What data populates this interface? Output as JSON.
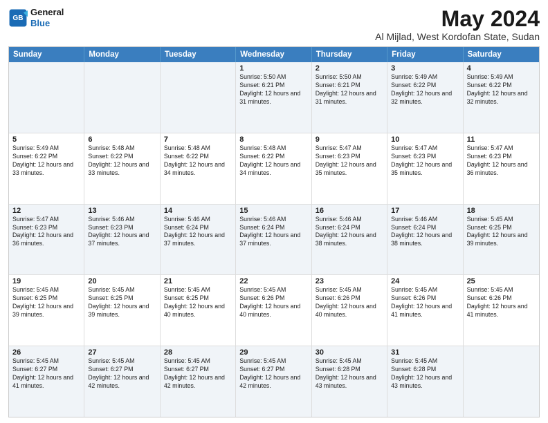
{
  "logo": {
    "general": "General",
    "blue": "Blue"
  },
  "title": "May 2024",
  "subtitle": "Al Mijlad, West Kordofan State, Sudan",
  "headers": [
    "Sunday",
    "Monday",
    "Tuesday",
    "Wednesday",
    "Thursday",
    "Friday",
    "Saturday"
  ],
  "rows": [
    [
      {
        "day": "",
        "text": ""
      },
      {
        "day": "",
        "text": ""
      },
      {
        "day": "",
        "text": ""
      },
      {
        "day": "1",
        "text": "Sunrise: 5:50 AM\nSunset: 6:21 PM\nDaylight: 12 hours and 31 minutes."
      },
      {
        "day": "2",
        "text": "Sunrise: 5:50 AM\nSunset: 6:21 PM\nDaylight: 12 hours and 31 minutes."
      },
      {
        "day": "3",
        "text": "Sunrise: 5:49 AM\nSunset: 6:22 PM\nDaylight: 12 hours and 32 minutes."
      },
      {
        "day": "4",
        "text": "Sunrise: 5:49 AM\nSunset: 6:22 PM\nDaylight: 12 hours and 32 minutes."
      }
    ],
    [
      {
        "day": "5",
        "text": "Sunrise: 5:49 AM\nSunset: 6:22 PM\nDaylight: 12 hours and 33 minutes."
      },
      {
        "day": "6",
        "text": "Sunrise: 5:48 AM\nSunset: 6:22 PM\nDaylight: 12 hours and 33 minutes."
      },
      {
        "day": "7",
        "text": "Sunrise: 5:48 AM\nSunset: 6:22 PM\nDaylight: 12 hours and 34 minutes."
      },
      {
        "day": "8",
        "text": "Sunrise: 5:48 AM\nSunset: 6:22 PM\nDaylight: 12 hours and 34 minutes."
      },
      {
        "day": "9",
        "text": "Sunrise: 5:47 AM\nSunset: 6:23 PM\nDaylight: 12 hours and 35 minutes."
      },
      {
        "day": "10",
        "text": "Sunrise: 5:47 AM\nSunset: 6:23 PM\nDaylight: 12 hours and 35 minutes."
      },
      {
        "day": "11",
        "text": "Sunrise: 5:47 AM\nSunset: 6:23 PM\nDaylight: 12 hours and 36 minutes."
      }
    ],
    [
      {
        "day": "12",
        "text": "Sunrise: 5:47 AM\nSunset: 6:23 PM\nDaylight: 12 hours and 36 minutes."
      },
      {
        "day": "13",
        "text": "Sunrise: 5:46 AM\nSunset: 6:23 PM\nDaylight: 12 hours and 37 minutes."
      },
      {
        "day": "14",
        "text": "Sunrise: 5:46 AM\nSunset: 6:24 PM\nDaylight: 12 hours and 37 minutes."
      },
      {
        "day": "15",
        "text": "Sunrise: 5:46 AM\nSunset: 6:24 PM\nDaylight: 12 hours and 37 minutes."
      },
      {
        "day": "16",
        "text": "Sunrise: 5:46 AM\nSunset: 6:24 PM\nDaylight: 12 hours and 38 minutes."
      },
      {
        "day": "17",
        "text": "Sunrise: 5:46 AM\nSunset: 6:24 PM\nDaylight: 12 hours and 38 minutes."
      },
      {
        "day": "18",
        "text": "Sunrise: 5:45 AM\nSunset: 6:25 PM\nDaylight: 12 hours and 39 minutes."
      }
    ],
    [
      {
        "day": "19",
        "text": "Sunrise: 5:45 AM\nSunset: 6:25 PM\nDaylight: 12 hours and 39 minutes."
      },
      {
        "day": "20",
        "text": "Sunrise: 5:45 AM\nSunset: 6:25 PM\nDaylight: 12 hours and 39 minutes."
      },
      {
        "day": "21",
        "text": "Sunrise: 5:45 AM\nSunset: 6:25 PM\nDaylight: 12 hours and 40 minutes."
      },
      {
        "day": "22",
        "text": "Sunrise: 5:45 AM\nSunset: 6:26 PM\nDaylight: 12 hours and 40 minutes."
      },
      {
        "day": "23",
        "text": "Sunrise: 5:45 AM\nSunset: 6:26 PM\nDaylight: 12 hours and 40 minutes."
      },
      {
        "day": "24",
        "text": "Sunrise: 5:45 AM\nSunset: 6:26 PM\nDaylight: 12 hours and 41 minutes."
      },
      {
        "day": "25",
        "text": "Sunrise: 5:45 AM\nSunset: 6:26 PM\nDaylight: 12 hours and 41 minutes."
      }
    ],
    [
      {
        "day": "26",
        "text": "Sunrise: 5:45 AM\nSunset: 6:27 PM\nDaylight: 12 hours and 41 minutes."
      },
      {
        "day": "27",
        "text": "Sunrise: 5:45 AM\nSunset: 6:27 PM\nDaylight: 12 hours and 42 minutes."
      },
      {
        "day": "28",
        "text": "Sunrise: 5:45 AM\nSunset: 6:27 PM\nDaylight: 12 hours and 42 minutes."
      },
      {
        "day": "29",
        "text": "Sunrise: 5:45 AM\nSunset: 6:27 PM\nDaylight: 12 hours and 42 minutes."
      },
      {
        "day": "30",
        "text": "Sunrise: 5:45 AM\nSunset: 6:28 PM\nDaylight: 12 hours and 43 minutes."
      },
      {
        "day": "31",
        "text": "Sunrise: 5:45 AM\nSunset: 6:28 PM\nDaylight: 12 hours and 43 minutes."
      },
      {
        "day": "",
        "text": ""
      }
    ]
  ],
  "alt_rows": [
    0,
    2,
    4
  ]
}
